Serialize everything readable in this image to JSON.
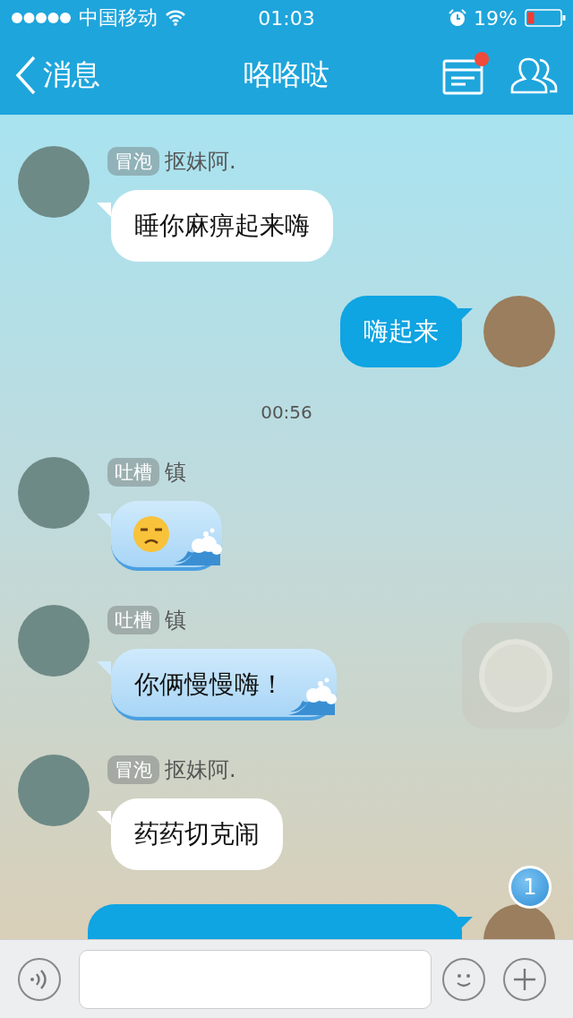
{
  "status_bar": {
    "carrier": "中国移动",
    "time": "01:03",
    "battery": "19%"
  },
  "nav": {
    "back": "消息",
    "title": "咯咯哒",
    "notice_dot": true
  },
  "messages": [
    {
      "kind": "incoming",
      "tag": "冒泡",
      "sender": "抠妹阿.",
      "text": "睡你麻痹起来嗨"
    },
    {
      "kind": "outgoing",
      "text": "嗨起来"
    },
    {
      "kind": "time",
      "text": "00:56"
    },
    {
      "kind": "incoming_wave_emoji",
      "tag": "吐槽",
      "sender": "镇"
    },
    {
      "kind": "incoming_wave",
      "tag": "吐槽",
      "sender": "镇",
      "text": "你俩慢慢嗨！"
    },
    {
      "kind": "incoming",
      "tag": "冒泡",
      "sender": "抠妹阿.",
      "text": "药药切克闹"
    },
    {
      "kind": "outgoing_cut"
    }
  ],
  "unread_badge": "1"
}
